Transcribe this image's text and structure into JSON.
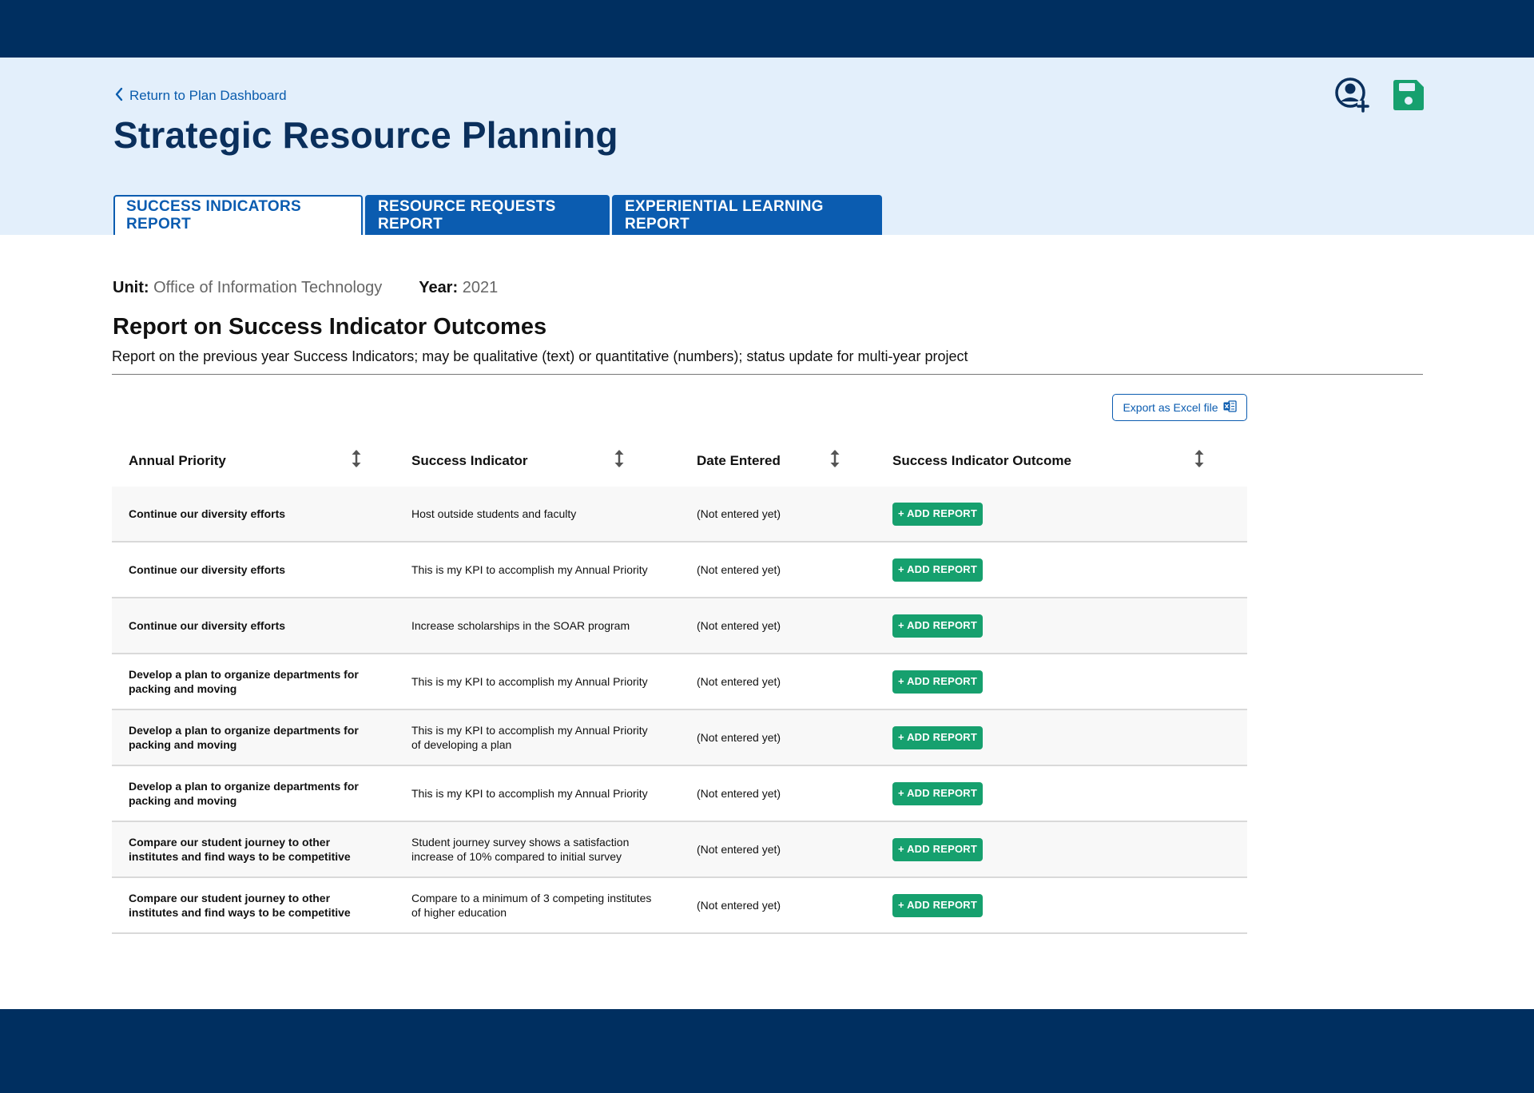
{
  "header": {
    "back_label": "Return to Plan Dashboard",
    "title": "Strategic Resource Planning",
    "icons": {
      "add_user": "user-add-icon",
      "save": "save-icon"
    }
  },
  "tabs": [
    {
      "label": "SUCCESS INDICATORS REPORT",
      "active": true
    },
    {
      "label": "RESOURCE REQUESTS REPORT",
      "active": false
    },
    {
      "label": "EXPERIENTIAL LEARNING REPORT",
      "active": false
    }
  ],
  "meta": {
    "unit_label": "Unit:",
    "unit_value": "Office of Information Technology",
    "year_label": "Year:",
    "year_value": "2021"
  },
  "section": {
    "title": "Report on Success Indicator Outcomes",
    "description": "Report on the previous year Success Indicators; may be qualitative (text) or quantitative (numbers); status update for multi-year project"
  },
  "export": {
    "label": "Export as Excel file",
    "icon": "excel-icon"
  },
  "table": {
    "columns": [
      "Annual Priority",
      "Success Indicator",
      "Date Entered",
      "Success Indicator Outcome"
    ],
    "button_label": "+ ADD REPORT",
    "rows": [
      {
        "priority": "Continue our diversity efforts",
        "indicator": "Host outside students and faculty",
        "date": "(Not entered yet)"
      },
      {
        "priority": "Continue our diversity efforts",
        "indicator": "This is my KPI to accomplish my Annual Priority",
        "date": "(Not entered yet)"
      },
      {
        "priority": "Continue our diversity efforts",
        "indicator": "Increase scholarships in the SOAR program",
        "date": "(Not entered yet)"
      },
      {
        "priority": "Develop a plan to organize departments for packing and moving",
        "indicator": "This is my KPI to accomplish my Annual Priority",
        "date": "(Not entered yet)"
      },
      {
        "priority": "Develop a plan to organize departments for packing and moving",
        "indicator": "This is my KPI to accomplish my Annual Priority of developing a plan",
        "date": "(Not entered yet)"
      },
      {
        "priority": "Develop a plan to organize departments for packing and moving",
        "indicator": "This is my KPI to accomplish my Annual Priority",
        "date": "(Not entered yet)"
      },
      {
        "priority": "Compare our student journey to other institutes and find ways to be competitive",
        "indicator": "Student journey survey shows a satisfaction increase of 10% compared to initial survey",
        "date": "(Not entered yet)"
      },
      {
        "priority": "Compare our student journey to other institutes and find ways to be competitive",
        "indicator": "Compare to a minimum of 3 competing institutes of higher education",
        "date": "(Not entered yet)"
      }
    ]
  },
  "colors": {
    "navy": "#002f60",
    "header_bg": "#e3effb",
    "tab_blue": "#0b5cb0",
    "accent_green": "#16a06e"
  }
}
